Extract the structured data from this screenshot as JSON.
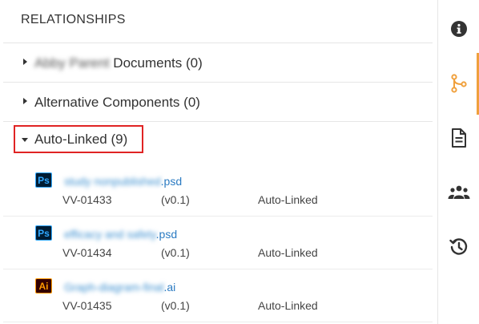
{
  "panel": {
    "title": "RELATIONSHIPS",
    "sections": [
      {
        "label_blurred": "Abby Parent",
        "label_suffix": "Documents (0)"
      },
      {
        "label": "Alternative Components (0)"
      }
    ],
    "expanded": {
      "label": "Auto-Linked (9)"
    },
    "items": [
      {
        "icon": "photoshop-icon",
        "icon_text": "Ps",
        "name_blurred": "study nonpublished",
        "ext": ".psd",
        "id": "VV-01433",
        "version": "(v0.1)",
        "relation": "Auto-Linked"
      },
      {
        "icon": "photoshop-icon",
        "icon_text": "Ps",
        "name_blurred": "efficacy and safety",
        "ext": ".psd",
        "id": "VV-01434",
        "version": "(v0.1)",
        "relation": "Auto-Linked"
      },
      {
        "icon": "illustrator-icon",
        "icon_text": "Ai",
        "name_blurred": "Graph-diagram-final",
        "ext": ".ai",
        "id": "VV-01435",
        "version": "(v0.1)",
        "relation": "Auto-Linked"
      }
    ]
  },
  "rail": {
    "accent_color": "#f0a03c",
    "buttons": [
      "info-icon",
      "relationships-icon",
      "document-icon",
      "users-icon",
      "history-icon"
    ]
  }
}
